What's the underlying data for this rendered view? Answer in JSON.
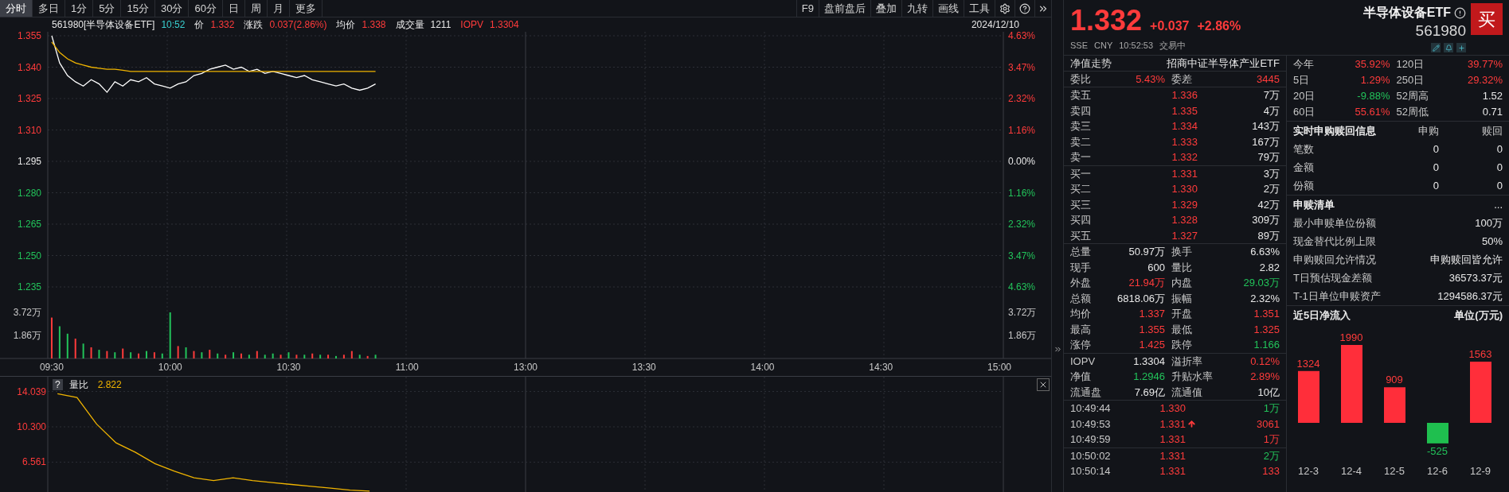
{
  "toolbar": {
    "periods": [
      {
        "label": "分时",
        "selected": true
      },
      {
        "label": "多日",
        "selected": false
      },
      {
        "label": "1分",
        "selected": false
      },
      {
        "label": "5分",
        "selected": false
      },
      {
        "label": "15分",
        "selected": false
      },
      {
        "label": "30分",
        "selected": false
      },
      {
        "label": "60分",
        "selected": false
      },
      {
        "label": "日",
        "selected": false
      },
      {
        "label": "周",
        "selected": false
      },
      {
        "label": "月",
        "selected": false
      },
      {
        "label": "更多",
        "selected": false
      }
    ],
    "tools": [
      "F9",
      "盘前盘后",
      "叠加",
      "九转",
      "画线",
      "工具"
    ]
  },
  "info_line": {
    "code_name": "561980[半导体设备ETF]",
    "time": "10:52",
    "fields": [
      {
        "label": "价",
        "label_highlight": false,
        "value": "1.332",
        "kind": "up"
      },
      {
        "label": "涨跌",
        "label_highlight": false,
        "value": "0.037(2.86%)",
        "kind": "up"
      },
      {
        "label": "均价",
        "label_highlight": false,
        "value": "1.338",
        "kind": "up"
      },
      {
        "label": "成交量",
        "label_highlight": false,
        "value": "1211",
        "kind": "flat"
      },
      {
        "label": "IOPV",
        "label_highlight": true,
        "value": "1.3304",
        "kind": "up"
      }
    ],
    "date": "2024/12/10"
  },
  "price_chart": {
    "pct_labels": [
      "4.63%",
      "3.47%",
      "2.32%",
      "1.16%",
      "0.00%",
      "1.16%",
      "2.32%",
      "3.47%",
      "4.63%"
    ],
    "chart_data": {
      "type": "line",
      "grid": true,
      "categories": [
        null,
        null,
        null,
        null,
        null,
        null,
        null,
        null,
        null,
        null,
        null,
        null,
        null,
        null,
        null,
        null,
        null,
        null,
        null,
        null,
        null,
        null,
        null,
        null,
        null,
        null,
        null,
        null,
        null,
        null,
        null,
        null,
        null,
        null,
        null,
        null,
        null,
        null,
        null,
        null,
        null,
        null,
        null,
        null,
        null,
        null,
        null,
        null,
        null,
        null,
        null,
        null,
        null,
        null,
        null,
        null,
        null,
        null,
        null,
        null,
        null,
        null,
        null,
        null,
        null,
        null,
        null,
        null,
        null,
        null,
        null,
        null,
        null,
        null,
        null,
        null,
        null,
        null,
        null,
        null,
        null,
        null,
        null,
        null,
        null,
        null,
        null,
        null,
        null,
        null,
        null,
        null,
        null,
        null,
        null,
        null,
        null,
        null,
        null,
        null,
        null,
        null,
        null,
        null,
        null,
        null,
        null,
        null,
        null,
        null,
        null,
        null,
        null,
        null,
        null,
        null,
        null,
        null,
        null,
        null,
        null
      ],
      "ylim": [
        1.235,
        1.355
      ],
      "yticks": [
        {
          "value": 1.355,
          "label": "1.355"
        },
        {
          "value": 1.34,
          "label": "1.340"
        },
        {
          "value": 1.325,
          "label": "1.325"
        },
        {
          "value": 1.31,
          "label": "1.310"
        },
        {
          "value": 1.295,
          "label": "1.295"
        },
        {
          "value": 1.28,
          "label": "1.280"
        },
        {
          "value": 1.265,
          "label": "1.265"
        },
        {
          "value": 1.25,
          "label": "1.250"
        },
        {
          "value": 1.235,
          "label": "1.235"
        }
      ],
      "series": [
        {
          "color": "#ffffff",
          "values": [
            1.355,
            1.342,
            1.336,
            1.333,
            1.331,
            1.334,
            1.332,
            1.328,
            1.333,
            1.331,
            1.334,
            1.333,
            1.335,
            1.332,
            1.331,
            1.33,
            1.332,
            1.333,
            1.336,
            1.337,
            1.339,
            1.34,
            1.341,
            1.339,
            1.34,
            1.338,
            1.339,
            1.337,
            1.338,
            1.337,
            1.336,
            1.335,
            1.336,
            1.334,
            1.333,
            1.332,
            1.331,
            1.332,
            1.33,
            1.329,
            1.33,
            1.332,
            null,
            null,
            null,
            null,
            null,
            null,
            null,
            null,
            null,
            null,
            null,
            null,
            null,
            null,
            null,
            null,
            null,
            null,
            null,
            null,
            null,
            null,
            null,
            null,
            null,
            null,
            null,
            null,
            null,
            null,
            null,
            null,
            null,
            null,
            null,
            null,
            null,
            null,
            null,
            null,
            null,
            null,
            null,
            null,
            null,
            null,
            null,
            null,
            null,
            null,
            null,
            null,
            null,
            null,
            null,
            null,
            null,
            null,
            null,
            null,
            null,
            null,
            null,
            null,
            null,
            null,
            null,
            null,
            null,
            null,
            null,
            null,
            null,
            null,
            null,
            null,
            null,
            null,
            null
          ]
        },
        {
          "color": "#f0b400",
          "values": [
            1.352,
            1.347,
            1.344,
            1.342,
            1.341,
            1.34,
            1.3395,
            1.339,
            1.339,
            1.3385,
            1.338,
            1.338,
            1.338,
            1.338,
            1.338,
            1.338,
            1.338,
            1.338,
            1.338,
            1.338,
            1.338,
            1.338,
            1.338,
            1.338,
            1.338,
            1.338,
            1.338,
            1.338,
            1.338,
            1.338,
            1.338,
            1.338,
            1.338,
            1.338,
            1.338,
            1.338,
            1.338,
            1.338,
            1.338,
            1.338,
            1.338,
            1.338,
            null,
            null,
            null,
            null,
            null,
            null,
            null,
            null,
            null,
            null,
            null,
            null,
            null,
            null,
            null,
            null,
            null,
            null,
            null,
            null,
            null,
            null,
            null,
            null,
            null,
            null,
            null,
            null,
            null,
            null,
            null,
            null,
            null,
            null,
            null,
            null,
            null,
            null,
            null,
            null,
            null,
            null,
            null,
            null,
            null,
            null,
            null,
            null,
            null,
            null,
            null,
            null,
            null,
            null,
            null,
            null,
            null,
            null,
            null,
            null,
            null,
            null,
            null,
            null,
            null,
            null,
            null,
            null,
            null,
            null,
            null,
            null,
            null,
            null,
            null,
            null,
            null,
            null,
            null
          ]
        }
      ]
    }
  },
  "volume_chart": {
    "right_labels": [
      "3.72万",
      "1.86万"
    ],
    "chart_data": {
      "type": "bar",
      "categories": [
        "09:30",
        null,
        null,
        null,
        null,
        null,
        null,
        null,
        null,
        null,
        null,
        null,
        null,
        null,
        null,
        "10:00",
        null,
        null,
        null,
        null,
        null,
        null,
        null,
        null,
        null,
        null,
        null,
        null,
        null,
        null,
        "10:30",
        null,
        null,
        null,
        null,
        null,
        null,
        null,
        null,
        null,
        null,
        null,
        null,
        null,
        null,
        "11:00",
        null,
        null,
        null,
        null,
        null,
        null,
        null,
        null,
        null,
        null,
        null,
        null,
        null,
        null,
        "13:00",
        null,
        null,
        null,
        null,
        null,
        null,
        null,
        null,
        null,
        null,
        null,
        null,
        null,
        null,
        "13:30",
        null,
        null,
        null,
        null,
        null,
        null,
        null,
        null,
        null,
        null,
        null,
        null,
        null,
        null,
        "14:00",
        null,
        null,
        null,
        null,
        null,
        null,
        null,
        null,
        null,
        null,
        null,
        null,
        null,
        null,
        "14:30",
        null,
        null,
        null,
        null,
        null,
        null,
        null,
        null,
        null,
        null,
        null,
        null,
        null,
        null,
        "15:00"
      ],
      "ylim": [
        0,
        3.72
      ],
      "yticks": [
        {
          "value": 3.72,
          "label": "3.72万"
        },
        {
          "value": 1.86,
          "label": "1.86万"
        }
      ],
      "series": [
        {
          "color": "#ff3b3b",
          "values": [
            3.3,
            null,
            null,
            1.6,
            null,
            0.9,
            null,
            0.6,
            null,
            0.8,
            null,
            0.4,
            null,
            0.5,
            null,
            null,
            1.0,
            null,
            0.6,
            null,
            0.7,
            null,
            0.3,
            null,
            0.4,
            null,
            0.6,
            null,
            null,
            0.3,
            null,
            0.3,
            null,
            0.4,
            null,
            0.3,
            null,
            0.3,
            0.6,
            null,
            0.2,
            null,
            null,
            null,
            null,
            null,
            null,
            null,
            null,
            null,
            null,
            null,
            null,
            null,
            null,
            null,
            null,
            null,
            null,
            null,
            null,
            null,
            null,
            null,
            null,
            null,
            null,
            null,
            null,
            null,
            null,
            null,
            null,
            null,
            null,
            null,
            null,
            null,
            null,
            null,
            null,
            null,
            null,
            null,
            null,
            null,
            null,
            null,
            null,
            null,
            null,
            null,
            null,
            null,
            null,
            null,
            null,
            null,
            null,
            null,
            null,
            null,
            null,
            null,
            null,
            null,
            null,
            null,
            null,
            null,
            null,
            null,
            null,
            null,
            null,
            null,
            null,
            null,
            null,
            null,
            null
          ]
        },
        {
          "color": "#22c35a",
          "values": [
            null,
            2.6,
            2.0,
            null,
            1.2,
            null,
            0.7,
            null,
            0.5,
            null,
            0.5,
            null,
            0.6,
            null,
            0.4,
            3.72,
            null,
            0.9,
            null,
            0.5,
            null,
            0.4,
            null,
            0.5,
            null,
            0.3,
            null,
            0.3,
            0.4,
            null,
            0.5,
            null,
            0.3,
            null,
            0.3,
            null,
            0.2,
            null,
            null,
            0.3,
            null,
            0.3,
            null,
            null,
            null,
            null,
            null,
            null,
            null,
            null,
            null,
            null,
            null,
            null,
            null,
            null,
            null,
            null,
            null,
            null,
            null,
            null,
            null,
            null,
            null,
            null,
            null,
            null,
            null,
            null,
            null,
            null,
            null,
            null,
            null,
            null,
            null,
            null,
            null,
            null,
            null,
            null,
            null,
            null,
            null,
            null,
            null,
            null,
            null,
            null,
            null,
            null,
            null,
            null,
            null,
            null,
            null,
            null,
            null,
            null,
            null,
            null,
            null,
            null,
            null,
            null,
            null,
            null,
            null,
            null,
            null,
            null,
            null,
            null,
            null,
            null,
            null,
            null,
            null,
            null,
            null
          ]
        }
      ]
    }
  },
  "indicator_pane": {
    "help": "?",
    "name": "量比",
    "value": "2.822",
    "chart_data": {
      "type": "line",
      "grid": true,
      "categories": [
        null,
        null,
        null,
        null,
        null,
        null,
        null,
        null,
        null,
        null,
        null,
        null,
        null,
        null,
        null,
        null,
        null,
        null,
        null,
        null,
        null,
        null,
        null,
        null,
        null,
        null,
        null,
        null,
        null,
        null,
        null,
        null,
        null,
        null,
        null,
        null,
        null,
        null,
        null,
        null,
        null,
        null,
        null,
        null,
        null,
        null,
        null,
        null,
        null
      ],
      "ylim": [
        3.4,
        15.6
      ],
      "yticks": [
        {
          "value": 14.039,
          "label": "14.039"
        },
        {
          "value": 10.3,
          "label": "10.300"
        },
        {
          "value": 6.561,
          "label": "6.561"
        }
      ],
      "series": [
        {
          "color": "#f0b400",
          "values": [
            13.8,
            13.4,
            10.6,
            8.6,
            7.6,
            6.4,
            5.6,
            4.9,
            4.6,
            4.9,
            4.6,
            4.4,
            4.2,
            4.0,
            3.8,
            3.6,
            3.5,
            null,
            null,
            null,
            null,
            null,
            null,
            null,
            null,
            null,
            null,
            null,
            null,
            null,
            null,
            null,
            null,
            null,
            null,
            null,
            null,
            null,
            null,
            null,
            null,
            null,
            null,
            null,
            null,
            null,
            null,
            null,
            null
          ]
        }
      ]
    }
  },
  "quote": {
    "price": "1.332",
    "change": "+0.037",
    "pct": "+2.86%",
    "name": "半导体设备ETF",
    "code": "561980",
    "buy_label": "买",
    "meta": [
      "SSE",
      "CNY",
      "10:52:53",
      "交易中"
    ]
  },
  "order_book": {
    "header": {
      "label": "净值走势",
      "value": "招商中证半导体产业ETF"
    },
    "ratio": [
      {
        "label": "委比",
        "value": "5.43%",
        "kind": "up"
      },
      {
        "label": "委差",
        "value": "3445",
        "kind": "up"
      }
    ],
    "asks": [
      {
        "label": "卖五",
        "price": "1.336",
        "volume": "7万"
      },
      {
        "label": "卖四",
        "price": "1.335",
        "volume": "4万"
      },
      {
        "label": "卖三",
        "price": "1.334",
        "volume": "143万"
      },
      {
        "label": "卖二",
        "price": "1.333",
        "volume": "167万"
      },
      {
        "label": "卖一",
        "price": "1.332",
        "volume": "79万"
      }
    ],
    "bids": [
      {
        "label": "买一",
        "price": "1.331",
        "volume": "3万"
      },
      {
        "label": "买二",
        "price": "1.330",
        "volume": "2万"
      },
      {
        "label": "买三",
        "price": "1.329",
        "volume": "42万"
      },
      {
        "label": "买四",
        "price": "1.328",
        "volume": "309万"
      },
      {
        "label": "买五",
        "price": "1.327",
        "volume": "89万"
      }
    ],
    "stats": [
      [
        {
          "label": "总量",
          "value": "50.97万",
          "kind": "flat"
        },
        {
          "label": "换手",
          "value": "6.63%",
          "kind": "flat"
        }
      ],
      [
        {
          "label": "现手",
          "value": "600",
          "kind": "flat"
        },
        {
          "label": "量比",
          "value": "2.82",
          "kind": "flat"
        }
      ],
      [
        {
          "label": "外盘",
          "value": "21.94万",
          "kind": "up"
        },
        {
          "label": "内盘",
          "value": "29.03万",
          "kind": "down"
        }
      ],
      [
        {
          "label": "总额",
          "value": "6818.06万",
          "kind": "flat"
        },
        {
          "label": "振幅",
          "value": "2.32%",
          "kind": "flat"
        }
      ],
      [
        {
          "label": "均价",
          "value": "1.337",
          "kind": "up"
        },
        {
          "label": "开盘",
          "value": "1.351",
          "kind": "up"
        }
      ],
      [
        {
          "label": "最高",
          "value": "1.355",
          "kind": "up"
        },
        {
          "label": "最低",
          "value": "1.325",
          "kind": "up"
        }
      ],
      [
        {
          "label": "涨停",
          "value": "1.425",
          "kind": "up"
        },
        {
          "label": "跌停",
          "value": "1.166",
          "kind": "down"
        }
      ]
    ],
    "nav": [
      [
        {
          "label": "IOPV",
          "value": "1.3304",
          "kind": "flat"
        },
        {
          "label": "溢折率",
          "value": "0.12%",
          "kind": "up"
        }
      ],
      [
        {
          "label": "净值",
          "value": "1.2946",
          "kind": "down"
        },
        {
          "label": "升贴水率",
          "value": "2.89%",
          "kind": "up"
        }
      ],
      [
        {
          "label": "流通盘",
          "value": "7.69亿",
          "kind": "flat"
        },
        {
          "label": "流通值",
          "value": "10亿",
          "kind": "flat"
        }
      ]
    ],
    "trades": [
      [
        {
          "time": "10:49:44",
          "price": "1.330",
          "uptick": false,
          "volume": "1万",
          "kind": "down"
        },
        {
          "time": "10:49:53",
          "price": "1.331",
          "uptick": true,
          "volume": "3061",
          "kind": "up"
        },
        {
          "time": "10:49:59",
          "price": "1.331",
          "uptick": false,
          "volume": "1万",
          "kind": "up"
        }
      ],
      [
        {
          "time": "10:50:02",
          "price": "1.331",
          "uptick": false,
          "volume": "2万",
          "kind": "down"
        },
        {
          "time": "10:50:14",
          "price": "1.331",
          "uptick": false,
          "volume": "133",
          "kind": "up"
        }
      ]
    ]
  },
  "returns": [
    [
      {
        "label": "今年",
        "value": "35.92%",
        "kind": "up"
      },
      {
        "label": "120日",
        "value": "39.77%",
        "kind": "up"
      }
    ],
    [
      {
        "label": "5日",
        "value": "1.29%",
        "kind": "up"
      },
      {
        "label": "250日",
        "value": "29.32%",
        "kind": "up"
      }
    ],
    [
      {
        "label": "20日",
        "value": "-9.88%",
        "kind": "down"
      },
      {
        "label": "52周高",
        "value": "1.52",
        "kind": "flat"
      }
    ],
    [
      {
        "label": "60日",
        "value": "55.61%",
        "kind": "up"
      },
      {
        "label": "52周低",
        "value": "0.71",
        "kind": "flat"
      }
    ]
  ],
  "creation_info": {
    "title": "实时申购赎回信息",
    "columns": [
      "申购",
      "赎回"
    ],
    "rows": [
      {
        "label": "笔数",
        "values": [
          "0",
          "0"
        ]
      },
      {
        "label": "金额",
        "values": [
          "0",
          "0"
        ]
      },
      {
        "label": "份额",
        "values": [
          "0",
          "0"
        ]
      }
    ]
  },
  "creation_list": {
    "title": "申赎清单",
    "more": "...",
    "rows": [
      {
        "label": "最小申赎单位份额",
        "value": "100万"
      },
      {
        "label": "现金替代比例上限",
        "value": "50%"
      },
      {
        "label": "申购赎回允许情况",
        "value": "申购赎回皆允许"
      },
      {
        "label": "T日预估现金差额",
        "value": "36573.37元"
      },
      {
        "label": "T-1日单位申赎资产",
        "value": "1294586.37元"
      }
    ]
  },
  "net_inflow": {
    "title": "近5日净流入",
    "unit": "单位(万元)",
    "chart_data": {
      "type": "bar",
      "categories": [
        "12-3",
        "12-4",
        "12-5",
        "12-6",
        "12-9"
      ],
      "values": [
        1324,
        1990,
        909,
        -525,
        1563
      ],
      "value_labels": [
        "1324",
        "1990",
        "909",
        "-525",
        "1563"
      ]
    }
  }
}
